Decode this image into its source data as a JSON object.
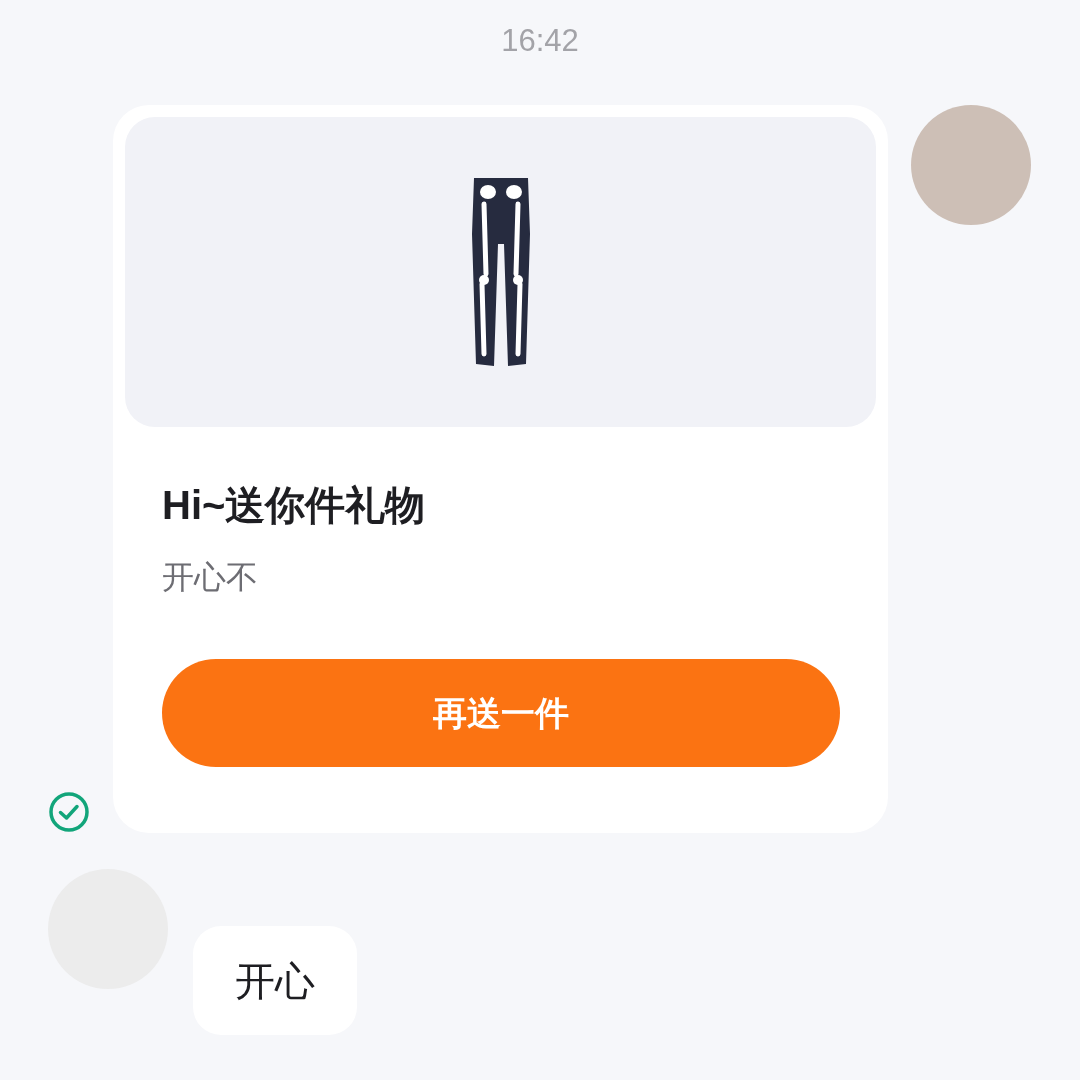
{
  "timestamp": "16:42",
  "messages": [
    {
      "kind": "gift",
      "title": "Hi~送你件礼物",
      "subtitle": "开心不",
      "button": "再送一件",
      "delivered": true
    },
    {
      "kind": "text",
      "text": "开心"
    }
  ]
}
